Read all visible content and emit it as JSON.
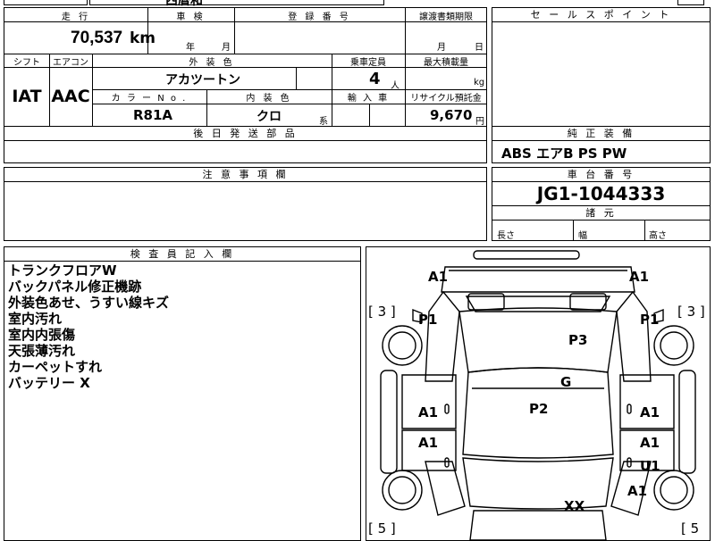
{
  "top_partial": {
    "text": "西暦和"
  },
  "main": {
    "mileage_header": "走 行",
    "mileage_value": "70,537",
    "mileage_unit": "km",
    "inspection_header": "車 検",
    "inspection_year": "年",
    "inspection_month": "月",
    "registration_header": "登 録 番 号",
    "transfer_header": "譲渡書類期限",
    "transfer_month": "月",
    "transfer_day": "日",
    "shift_header": "シフト",
    "aircon_header": "エアコン",
    "exterior_color_header": "外 装 色",
    "capacity_header": "乗車定員",
    "max_load_header": "最大積載量",
    "shift_value": "IAT",
    "aircon_value": "AAC",
    "exterior_color_value": "アカツートン",
    "capacity_value": "4",
    "capacity_unit": "人",
    "max_load_unit": "kg",
    "color_no_header": "カ ラ ー N o .",
    "interior_color_header": "内 装 色",
    "import_header": "輸 入 車",
    "recycle_header": "リサイクル預託金",
    "color_no_value": "R81A",
    "interior_color_value": "クロ",
    "interior_color_suffix": "系",
    "recycle_value": "9,670",
    "recycle_unit": "円",
    "later_parts_header": "後 日 発 送 部 品",
    "notes_header": "注 意 事 項 欄"
  },
  "side": {
    "selling_points_header": "セ ー ル ス ポ イ ン ト",
    "equipment_header": "純 正 装 備",
    "equipment_value": "ABS エアB PS PW",
    "chassis_header": "車 台 番 号",
    "chassis_value": "JG1-1044333",
    "dimensions_header": "諸 元",
    "length_label": "長さ",
    "width_label": "幅",
    "height_label": "高さ"
  },
  "inspector": {
    "header": "検 査 員 記 入 欄",
    "notes": [
      "トランクフロアW",
      "バックパネル修正機跡",
      "外装色あせ、うすい線キズ",
      "室内汚れ",
      "室内内張傷",
      "天張薄汚れ",
      "カーペットすれ",
      "バッテリー X"
    ]
  },
  "diagram": {
    "marks": {
      "a1_top_left": "A1",
      "a1_top_right": "A1",
      "tire_left_top": "[ 3 ]",
      "tire_right_top": "[ 3 ]",
      "p1_left": "P1",
      "p1_right": "P1",
      "p3": "P3",
      "g": "G",
      "p2": "P2",
      "a1_left_1": "A1",
      "a1_right_1": "A1",
      "a1_left_2": "A1",
      "a1_right_2": "A1",
      "u1": "U1",
      "a1_right_3": "A1",
      "xx": "XX",
      "tire_left_bottom": "[ 5 ]",
      "tire_right_bottom": "[ 5"
    }
  }
}
